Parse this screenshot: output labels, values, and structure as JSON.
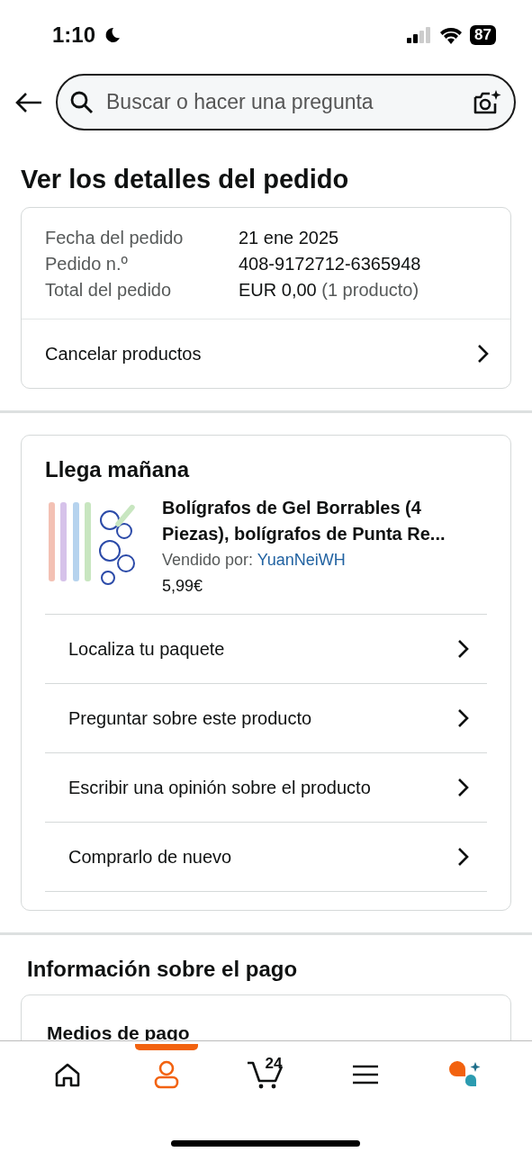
{
  "status_bar": {
    "time": "1:10",
    "battery": "87"
  },
  "search": {
    "placeholder": "Buscar o hacer una pregunta"
  },
  "title": "Ver los detalles del pedido",
  "order": {
    "details": [
      {
        "label": "Fecha del pedido",
        "value": "21 ene 2025"
      },
      {
        "label": "Pedido n.º",
        "value": "408-9172712-6365948"
      },
      {
        "label": "Total del pedido",
        "value": "EUR 0,00",
        "note": "(1 producto)"
      }
    ],
    "action": "Cancelar productos"
  },
  "shipment": {
    "heading": "Llega mañana",
    "product": {
      "name": "Bolígrafos de Gel Borrables (4 Piezas), bolígrafos de Punta Re...",
      "seller_label": "Vendido por:",
      "seller": "YuanNeiWH",
      "price": "5,99€"
    },
    "actions": [
      "Localiza tu paquete",
      "Preguntar sobre este producto",
      "Escribir una opinión sobre el producto",
      "Comprarlo de nuevo"
    ]
  },
  "payment": {
    "heading": "Información sobre el pago",
    "card_title": "Medios de pago"
  },
  "nav": [
    {
      "kind": "home",
      "selected": false
    },
    {
      "kind": "account",
      "selected": true
    },
    {
      "kind": "cart",
      "selected": false,
      "count": "24"
    },
    {
      "kind": "menu",
      "selected": false
    },
    {
      "kind": "assistant",
      "selected": false
    }
  ]
}
